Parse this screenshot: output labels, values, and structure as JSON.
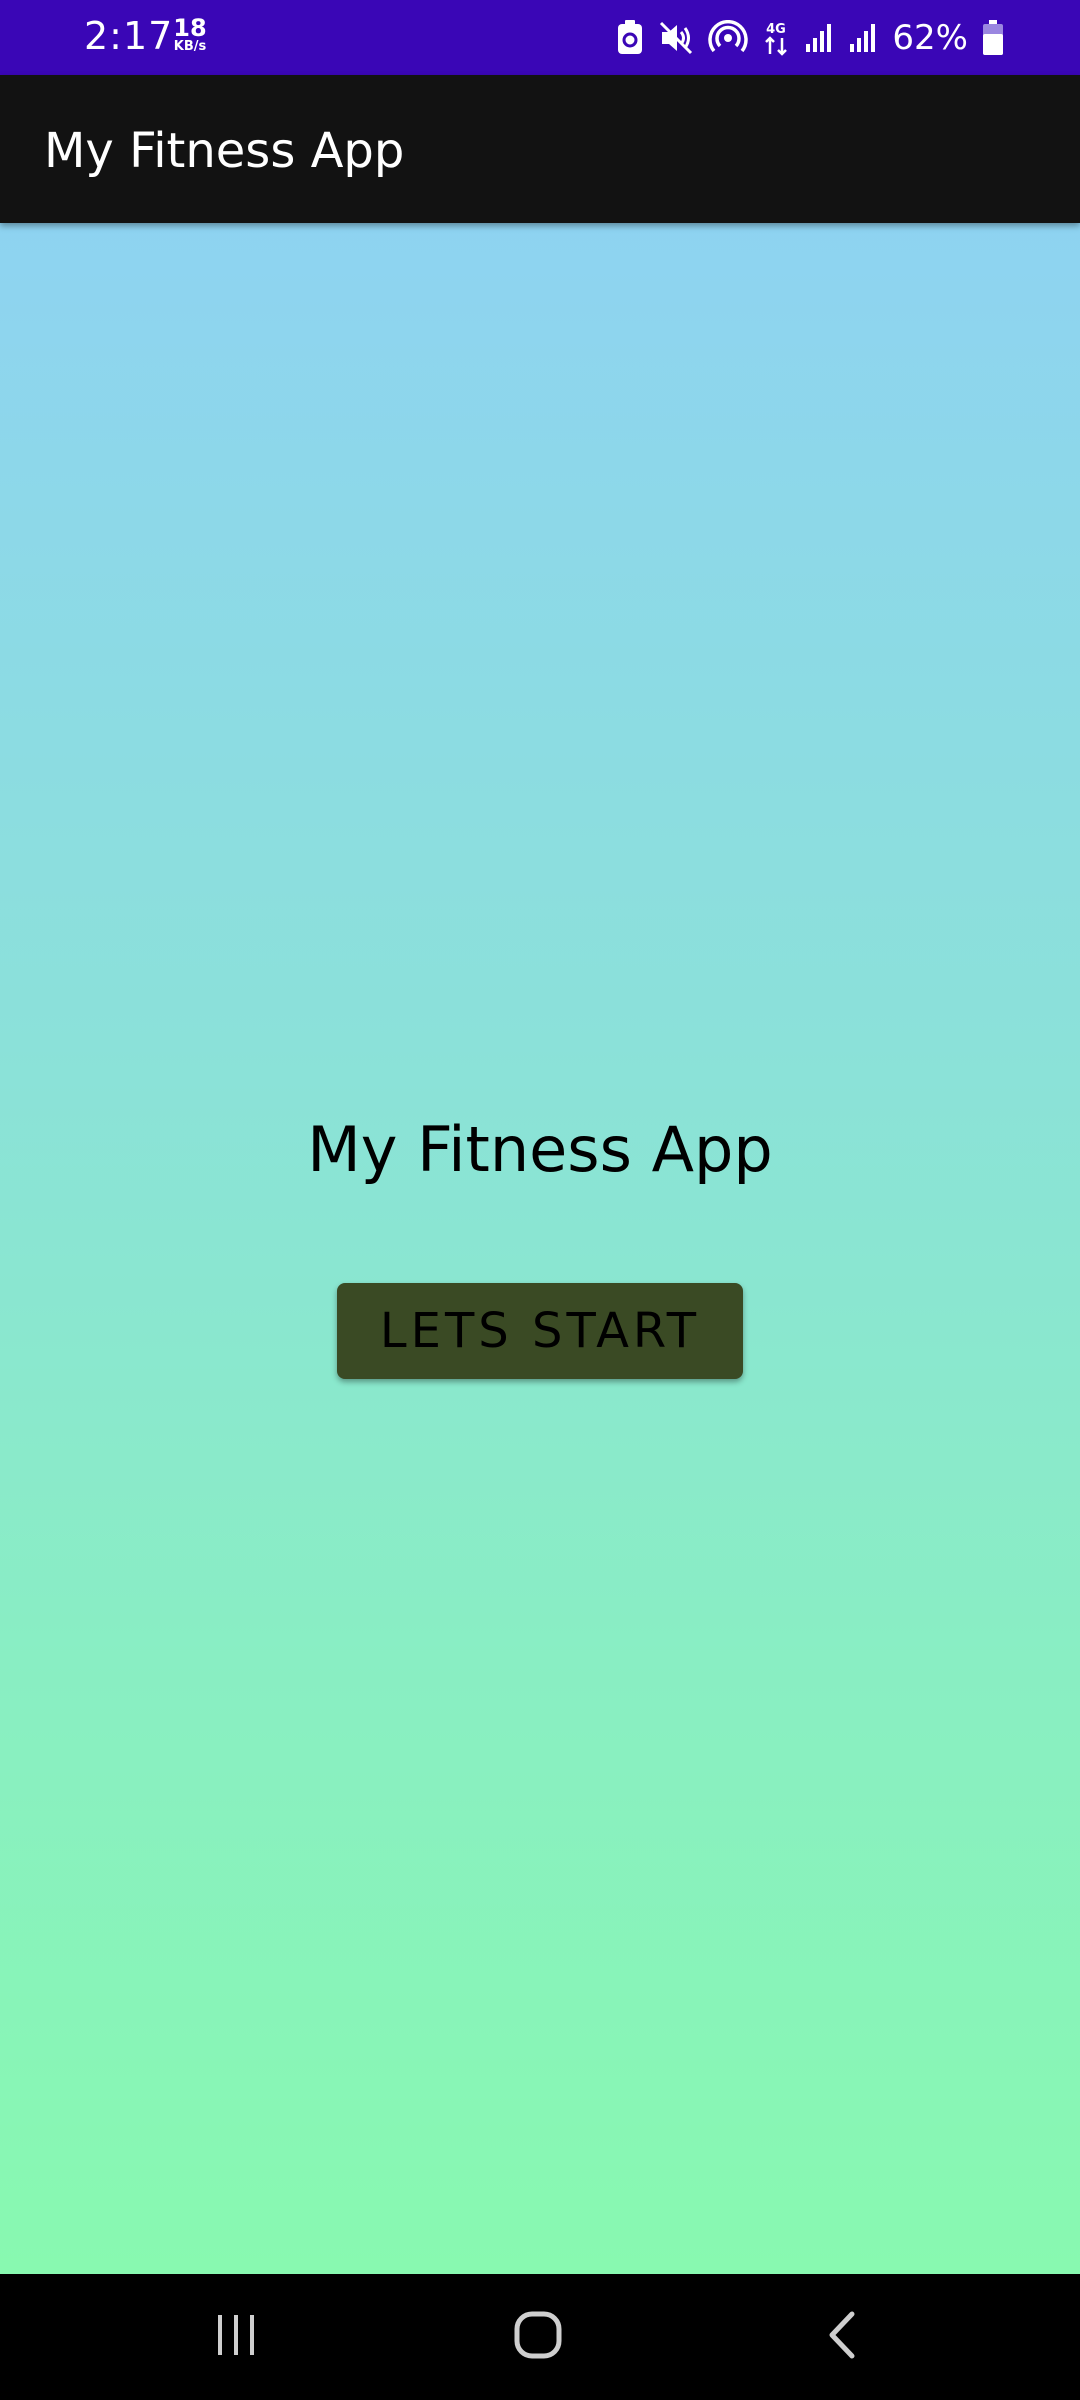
{
  "status_bar": {
    "time": "2:17",
    "net_speed_value": "18",
    "net_speed_unit": "KB/s",
    "battery_percent": "62%",
    "network_type": "4G",
    "icons": [
      "battery-saver-icon",
      "mute-icon",
      "hotspot-icon",
      "data-arrows-icon",
      "signal-icon",
      "signal-icon",
      "battery-icon"
    ],
    "background_color": "#3a06b6"
  },
  "app_bar": {
    "title": "My Fitness App",
    "background_color": "#121212"
  },
  "main": {
    "title": "My Fitness App",
    "start_button_label": "LETS START",
    "button_color": "#3a4a24",
    "gradient_top": "#8ed3f1",
    "gradient_bottom": "#88f9b0"
  },
  "nav_bar": {
    "buttons": [
      "recents-icon",
      "home-icon",
      "back-icon"
    ]
  }
}
